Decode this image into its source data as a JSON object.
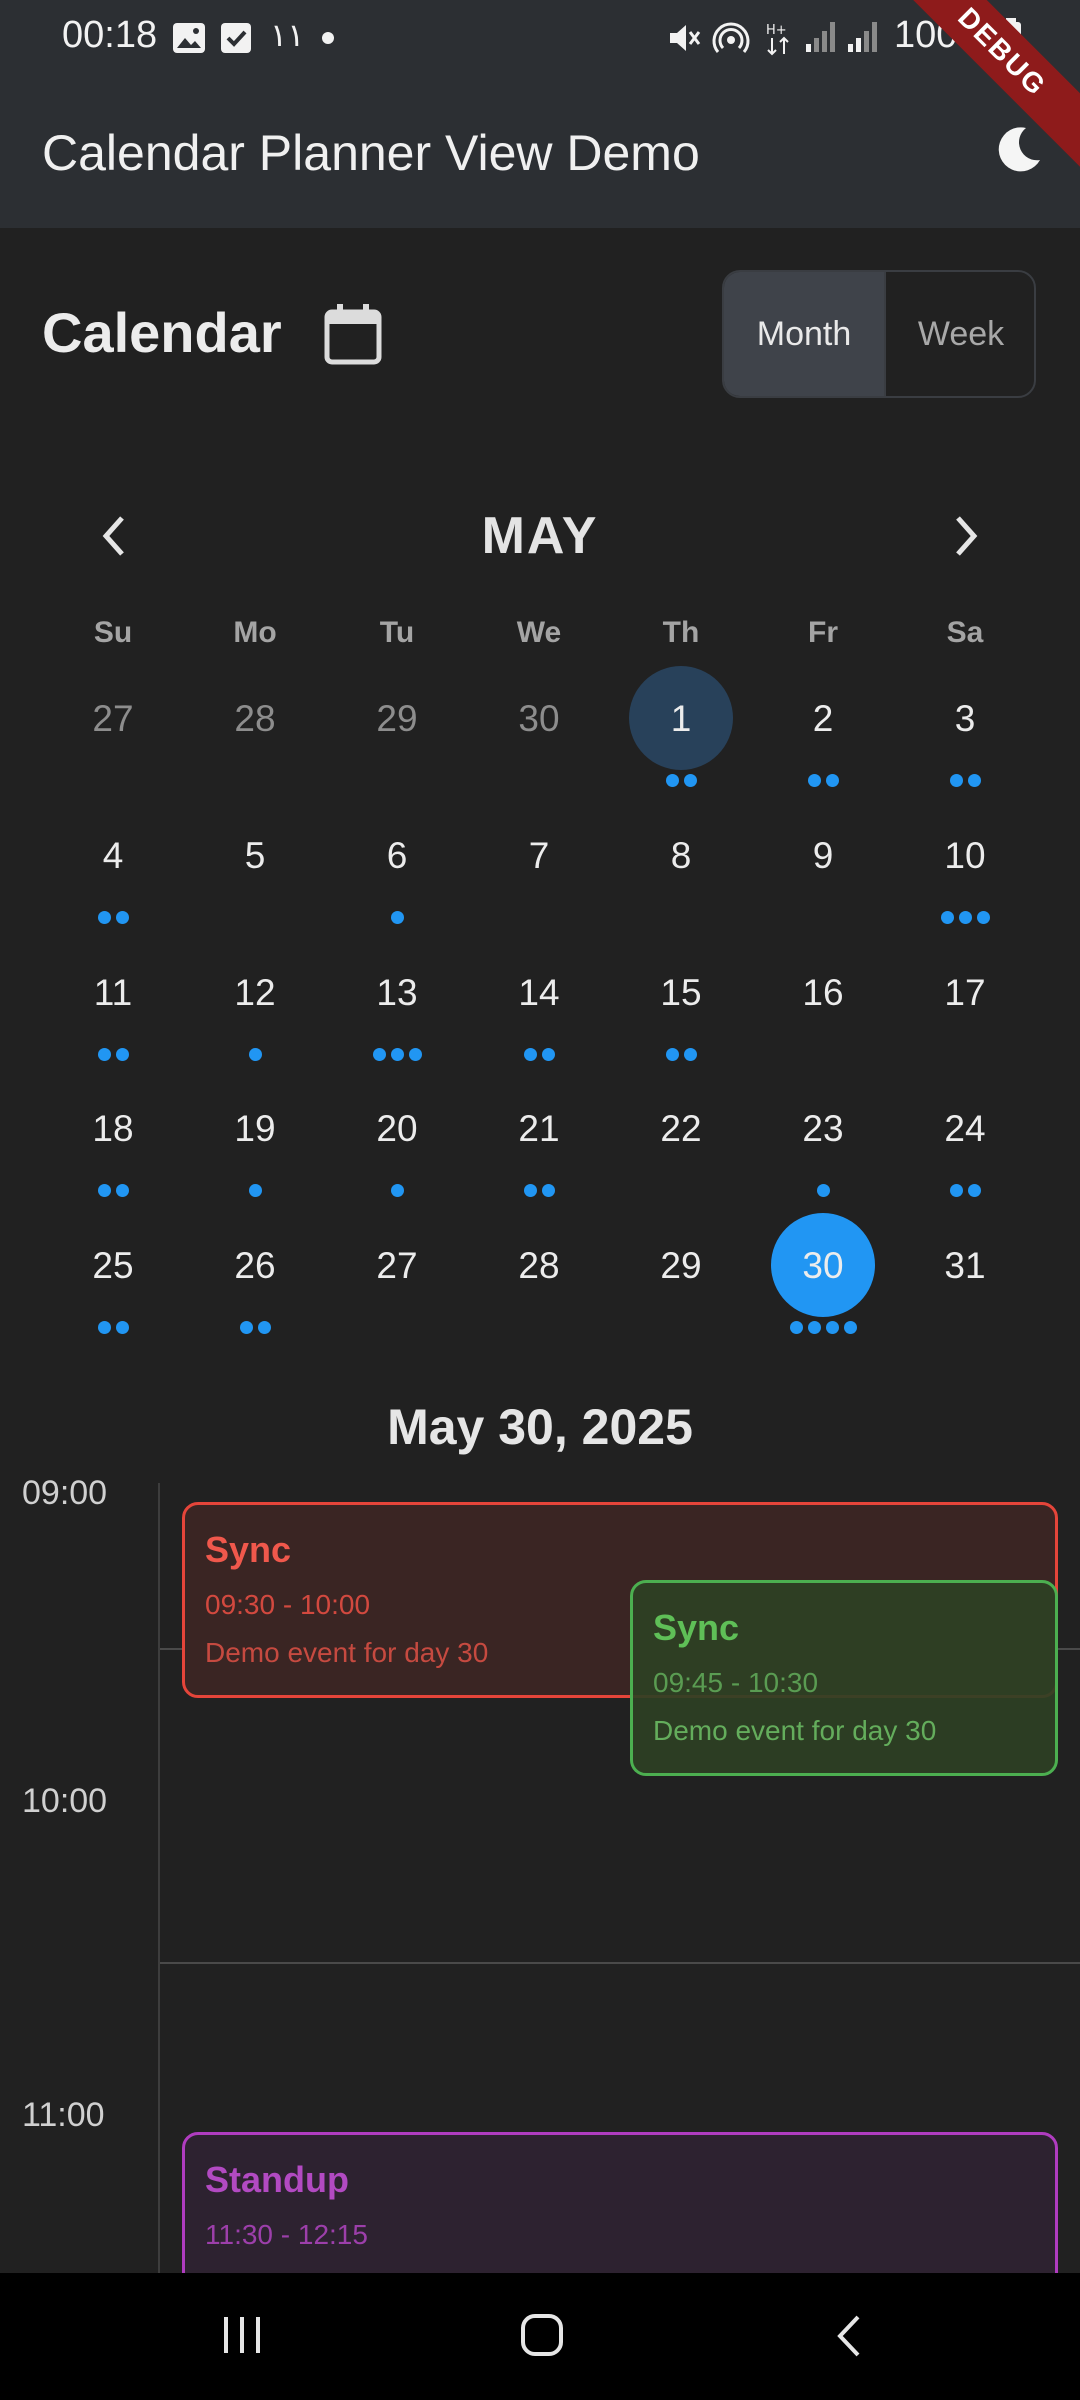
{
  "status_bar": {
    "time": "00:18",
    "extra_indicator": "١١",
    "battery": "100%"
  },
  "app_bar": {
    "title": "Calendar Planner View Demo",
    "theme_icon": "moon-icon",
    "debug_label": "DEBUG"
  },
  "header": {
    "heading": "Calendar",
    "calendar_icon": "calendar-icon",
    "view_toggle": {
      "month": "Month",
      "week": "Week",
      "selected": "Month"
    }
  },
  "month_nav": {
    "title": "MAY",
    "prev_icon": "chevron-left-icon",
    "next_icon": "chevron-right-icon"
  },
  "weekdays": [
    "Su",
    "Mo",
    "Tu",
    "We",
    "Th",
    "Fr",
    "Sa"
  ],
  "weeks": [
    [
      {
        "d": "27",
        "other": true,
        "dots": 0
      },
      {
        "d": "28",
        "other": true,
        "dots": 0
      },
      {
        "d": "29",
        "other": true,
        "dots": 0
      },
      {
        "d": "30",
        "other": true,
        "dots": 0
      },
      {
        "d": "1",
        "dots": 2,
        "today": true
      },
      {
        "d": "2",
        "dots": 2
      },
      {
        "d": "3",
        "dots": 2
      }
    ],
    [
      {
        "d": "4",
        "dots": 2
      },
      {
        "d": "5",
        "dots": 0
      },
      {
        "d": "6",
        "dots": 1
      },
      {
        "d": "7",
        "dots": 0
      },
      {
        "d": "8",
        "dots": 0
      },
      {
        "d": "9",
        "dots": 0
      },
      {
        "d": "10",
        "dots": 3
      }
    ],
    [
      {
        "d": "11",
        "dots": 2
      },
      {
        "d": "12",
        "dots": 1
      },
      {
        "d": "13",
        "dots": 3
      },
      {
        "d": "14",
        "dots": 2
      },
      {
        "d": "15",
        "dots": 2
      },
      {
        "d": "16",
        "dots": 0
      },
      {
        "d": "17",
        "dots": 0
      }
    ],
    [
      {
        "d": "18",
        "dots": 2
      },
      {
        "d": "19",
        "dots": 1
      },
      {
        "d": "20",
        "dots": 1
      },
      {
        "d": "21",
        "dots": 2
      },
      {
        "d": "22",
        "dots": 0
      },
      {
        "d": "23",
        "dots": 1
      },
      {
        "d": "24",
        "dots": 2
      }
    ],
    [
      {
        "d": "25",
        "dots": 2
      },
      {
        "d": "26",
        "dots": 2
      },
      {
        "d": "27",
        "dots": 0
      },
      {
        "d": "28",
        "dots": 0
      },
      {
        "d": "29",
        "dots": 0
      },
      {
        "d": "30",
        "dots": 4,
        "selected": true
      },
      {
        "d": "31",
        "dots": 0
      }
    ]
  ],
  "selected_date": "May 30, 2025",
  "timeline": {
    "hours": [
      "09:00",
      "10:00",
      "11:00"
    ],
    "events": [
      {
        "title": "Sync",
        "time": "09:30 - 10:00",
        "desc": "Demo event for day 30",
        "color": "#e5453a"
      },
      {
        "title": "Sync",
        "time": "09:45 - 10:30",
        "desc": "Demo event for day 30",
        "color": "#4caf50"
      },
      {
        "title": "Standup",
        "time": "11:30 - 12:15",
        "desc": "",
        "color": "#b03cc0"
      }
    ]
  },
  "nav_bar": {
    "recents_icon": "recents-icon",
    "home_icon": "home-icon",
    "back_icon": "back-icon"
  },
  "colors": {
    "accent": "#2196f3",
    "today_circle": "#28415a",
    "background": "#212121",
    "app_bar": "#2c2f33"
  }
}
